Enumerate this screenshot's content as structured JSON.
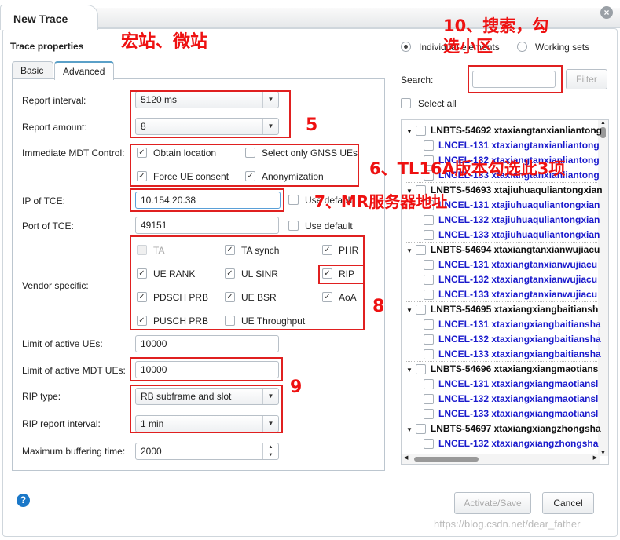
{
  "window": {
    "title": "New Trace",
    "close_icon": "close-icon"
  },
  "left": {
    "heading": "Trace properties",
    "tabs": [
      {
        "label": "Basic"
      },
      {
        "label": "Advanced",
        "active": true
      }
    ],
    "report_interval": {
      "label": "Report interval:",
      "value": "5120 ms"
    },
    "report_amount": {
      "label": "Report amount:",
      "value": "8"
    },
    "mdt": {
      "label": "Immediate MDT Control:",
      "options": [
        {
          "label": "Obtain location",
          "checked": true
        },
        {
          "label": "Select only GNSS UEs",
          "checked": false
        },
        {
          "label": "Force UE consent",
          "checked": true
        },
        {
          "label": "Anonymization",
          "checked": true
        }
      ]
    },
    "ip_tce": {
      "label": "IP of TCE:",
      "value": "10.154.20.38",
      "use_default": "Use default"
    },
    "port_tce": {
      "label": "Port of TCE:",
      "value": "49151",
      "use_default": "Use default"
    },
    "vendor": {
      "label": "Vendor specific:",
      "options": [
        {
          "label": "TA",
          "checked": false,
          "disabled": true
        },
        {
          "label": "TA synch",
          "checked": true
        },
        {
          "label": "PHR",
          "checked": true
        },
        {
          "label": "UE RANK",
          "checked": true
        },
        {
          "label": "UL SINR",
          "checked": true
        },
        {
          "label": "RIP",
          "checked": true
        },
        {
          "label": "PDSCH PRB",
          "checked": true
        },
        {
          "label": "UE BSR",
          "checked": true
        },
        {
          "label": "AoA",
          "checked": true
        },
        {
          "label": "PUSCH PRB",
          "checked": true
        },
        {
          "label": "UE Throughput",
          "checked": false
        }
      ]
    },
    "limit_ues": {
      "label": "Limit of active UEs:",
      "value": "10000"
    },
    "limit_mdt": {
      "label": "Limit of active MDT UEs:",
      "value": "10000"
    },
    "rip_type": {
      "label": "RIP type:",
      "value": "RB subframe and slot"
    },
    "rip_interval": {
      "label": "RIP report interval:",
      "value": "1 min"
    },
    "max_buffer": {
      "label": "Maximum buffering time:",
      "value": "2000"
    }
  },
  "right": {
    "mode": [
      {
        "label": "Individual elements",
        "selected": true
      },
      {
        "label": "Working sets",
        "selected": false
      }
    ],
    "search_label": "Search:",
    "search_value": "",
    "filter": "Filter",
    "select_all": "Select all",
    "tree": [
      {
        "t": "p",
        "label": "LNBTS-54692 xtaxiangtanxianliantong"
      },
      {
        "t": "c",
        "label": "LNCEL-131 xtaxiangtanxianliantong"
      },
      {
        "t": "c",
        "label": "LNCEL-132 xtaxiangtanxianliantong"
      },
      {
        "t": "c",
        "label": "LNCEL-133 xtaxiangtanxianliantong"
      },
      {
        "t": "p",
        "label": "LNBTS-54693 xtajiuhuaquliantongxian"
      },
      {
        "t": "c",
        "label": "LNCEL-131 xtajiuhuaquliantongxian"
      },
      {
        "t": "c",
        "label": "LNCEL-132 xtajiuhuaquliantongxian"
      },
      {
        "t": "c",
        "label": "LNCEL-133 xtajiuhuaquliantongxian"
      },
      {
        "t": "p",
        "label": "LNBTS-54694 xtaxiangtanxianwujiacu"
      },
      {
        "t": "c",
        "label": "LNCEL-131 xtaxiangtanxianwujiacu"
      },
      {
        "t": "c",
        "label": "LNCEL-132 xtaxiangtanxianwujiacu"
      },
      {
        "t": "c",
        "label": "LNCEL-133 xtaxiangtanxianwujiacu"
      },
      {
        "t": "p",
        "label": "LNBTS-54695 xtaxiangxiangbaitiansh"
      },
      {
        "t": "c",
        "label": "LNCEL-131 xtaxiangxiangbaitiansha"
      },
      {
        "t": "c",
        "label": "LNCEL-132 xtaxiangxiangbaitiansha"
      },
      {
        "t": "c",
        "label": "LNCEL-133 xtaxiangxiangbaitiansha"
      },
      {
        "t": "p",
        "label": "LNBTS-54696 xtaxiangxiangmaotians"
      },
      {
        "t": "c",
        "label": "LNCEL-131 xtaxiangxiangmaotiansl"
      },
      {
        "t": "c",
        "label": "LNCEL-132 xtaxiangxiangmaotiansl"
      },
      {
        "t": "c",
        "label": "LNCEL-133 xtaxiangxiangmaotiansl"
      },
      {
        "t": "p",
        "label": "LNBTS-54697 xtaxiangxiangzhongsha"
      },
      {
        "t": "c",
        "label": "LNCEL-132 xtaxiangxiangzhongsha"
      }
    ]
  },
  "footer": {
    "help_icon": "help-icon",
    "activate": "Activate/Save",
    "cancel": "Cancel"
  },
  "annotations": {
    "a1": "宏站、微站",
    "a5": "5",
    "a6": "6、TL16A版本勾选此3项",
    "a7": "7、MR服务器地址",
    "a8": "8",
    "a9": "9",
    "a10a": "10、搜索，勾",
    "a10b": "选小区",
    "color": "#ee1111"
  },
  "watermark": "https://blog.csdn.net/dear_father"
}
